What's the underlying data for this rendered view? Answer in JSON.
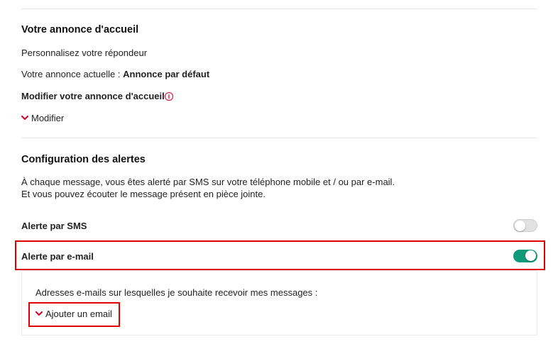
{
  "greeting": {
    "heading": "Votre annonce d'accueil",
    "subtitle": "Personnalisez votre répondeur",
    "current_label": "Votre annonce actuelle : ",
    "current_value": "Annonce par défaut",
    "modify_heading": "Modifier votre annonce d'accueil",
    "info_icon_glyph": "i",
    "modify_link": "Modifier"
  },
  "alerts": {
    "heading": "Configuration des alertes",
    "description_line1": "À chaque message, vous êtes alerté par SMS sur votre téléphone mobile et / ou par e-mail.",
    "description_line2": "Et vous pouvez écouter le message présent en pièce jointe.",
    "sms": {
      "label": "Alerte par SMS",
      "enabled": false
    },
    "email": {
      "label": "Alerte par e-mail",
      "enabled": true
    },
    "email_panel": {
      "addresses_label": "Adresses e-mails sur lesquelles je souhaite recevoir mes messages :",
      "add_email_link": "Ajouter un email"
    }
  },
  "colors": {
    "accent_red": "#d6002a",
    "toggle_on": "#0f9b7a",
    "highlight": "#e10000"
  }
}
